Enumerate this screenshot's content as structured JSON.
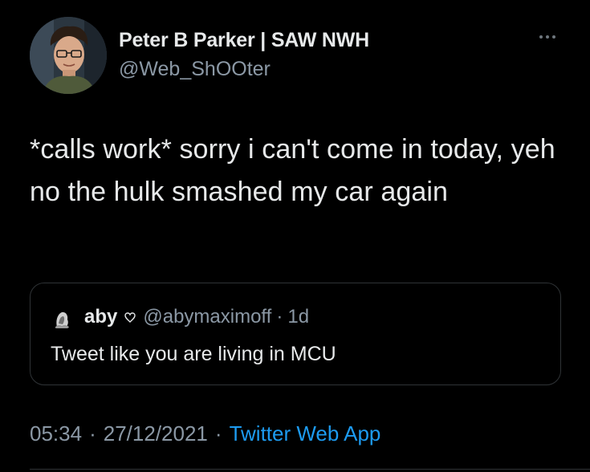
{
  "author": {
    "display_name": "Peter B Parker | SAW NWH",
    "handle": "@Web_ShOOter",
    "avatar_icon": "avatar-icon"
  },
  "tweet": {
    "text": "*calls work* sorry i can't come in today, yeh no the hulk smashed my car again"
  },
  "quote": {
    "display_name": "aby",
    "emoji_icon": "heart-outline-icon",
    "handle": "@abymaximoff",
    "separator": "·",
    "time": "1d",
    "text": "Tweet like you are living in MCU"
  },
  "meta": {
    "time": "05:34",
    "separator": "·",
    "date": "27/12/2021",
    "separator2": "·",
    "source": "Twitter Web App"
  },
  "colors": {
    "background": "#000000",
    "primary_text": "#e7e9ea",
    "secondary_text": "#8b98a5",
    "link": "#1d9bf0",
    "border": "#2f3336"
  }
}
